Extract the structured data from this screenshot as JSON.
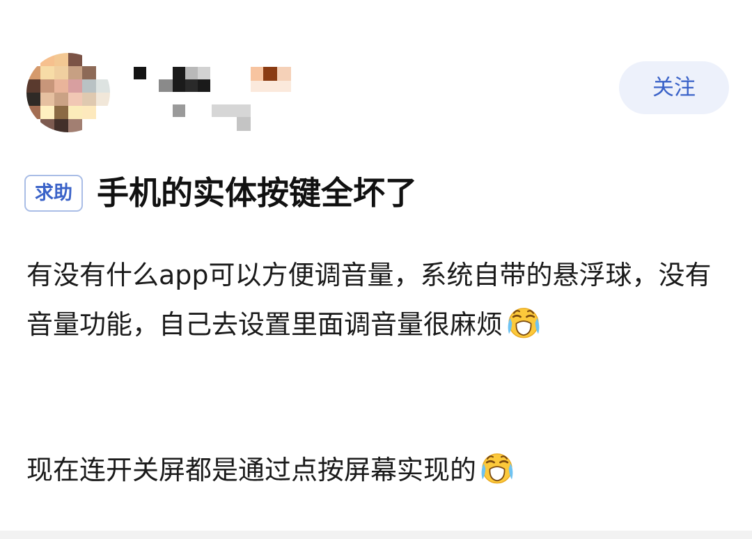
{
  "header": {
    "avatar_icon": "pixelated-avatar",
    "follow_label": "关注"
  },
  "post": {
    "tag": "求助",
    "title": "手机的实体按键全坏了",
    "paragraph_1": "有没有什么app可以方便调音量，系统自带的悬浮球，没有音量功能，自己去设置里面调音量很麻烦",
    "paragraph_2": "现在连开关屏都是通过点按屏幕实现的",
    "emoji_icon": "loudly-crying-face-emoji"
  },
  "colors": {
    "accent": "#3a62c8",
    "follow_bg": "#edf1fb",
    "tag_border": "#a9bde6"
  }
}
